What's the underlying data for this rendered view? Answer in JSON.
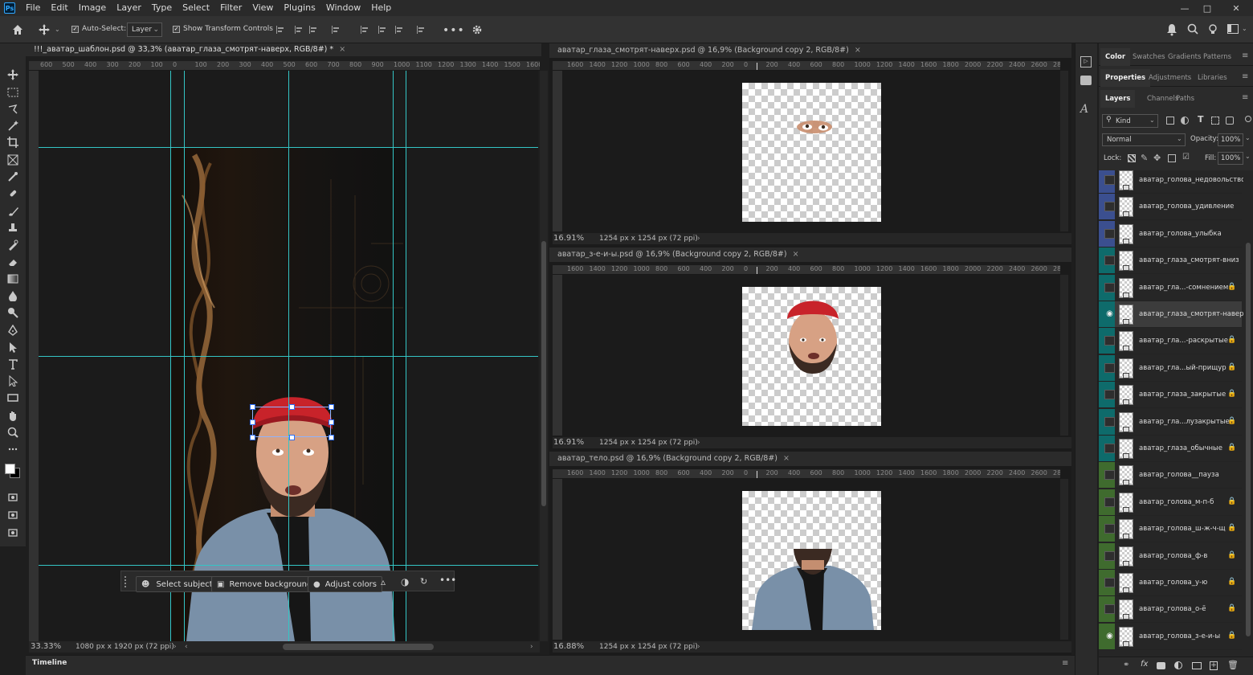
{
  "app": {
    "logo": "Ps"
  },
  "menu": [
    "File",
    "Edit",
    "Image",
    "Layer",
    "Type",
    "Select",
    "Filter",
    "View",
    "Plugins",
    "Window",
    "Help"
  ],
  "options_bar": {
    "auto_select_label": "Auto-Select:",
    "layer_dropdown": "Layer",
    "show_transform_label": "Show Transform Controls"
  },
  "documents": {
    "main": {
      "tab": "!!!_аватар_шаблон.psd @ 33,3% (аватар_глаза_смотрят-наверх, RGB/8#) *",
      "ruler_labels": [
        "600",
        "500",
        "400",
        "300",
        "200",
        "100",
        "0",
        "100",
        "200",
        "300",
        "400",
        "500",
        "600",
        "700",
        "800",
        "900",
        "1000",
        "1100",
        "1200",
        "1300",
        "1400",
        "1500",
        "1600"
      ],
      "zoom": "33.33%",
      "info": "1080 px x 1920 px (72 ppi)"
    },
    "doc2": {
      "tab": "аватар_глаза_смотрят-наверх.psd @ 16,9% (Background copy 2, RGB/8#)",
      "zoom": "16.91%",
      "info": "1254 px x 1254 px (72 ppi)"
    },
    "doc3": {
      "tab": "аватар_з-е-и-ы.psd @ 16,9% (Background copy 2, RGB/8#)",
      "zoom": "16.91%",
      "info": "1254 px x 1254 px (72 ppi)"
    },
    "doc4": {
      "tab": "аватар_тело.psd @ 16,9% (Background copy 2, RGB/8#)",
      "zoom": "16.88%",
      "info": "1254 px x 1254 px (72 ppi)"
    },
    "small_ruler_labels": [
      "1600",
      "1400",
      "1200",
      "1000",
      "800",
      "600",
      "400",
      "200",
      "0",
      "200",
      "400",
      "600",
      "800",
      "1000",
      "1200",
      "1400",
      "1600",
      "1800",
      "2000",
      "2200",
      "2400",
      "2600",
      "2800"
    ]
  },
  "contextual_bar": {
    "select_subject": "Select subject",
    "remove_background": "Remove background",
    "adjust_colors": "Adjust colors"
  },
  "timeline": {
    "label": "Timeline"
  },
  "panels": {
    "top_tabs": [
      "Color",
      "Swatches",
      "Gradients",
      "Patterns"
    ],
    "mid_tabs": [
      "Properties",
      "Adjustments",
      "Libraries"
    ],
    "layer_tabs": [
      "Layers",
      "Channels",
      "Paths"
    ],
    "kind_label": "Kind",
    "blend_mode": "Normal",
    "opacity_label": "Opacity:",
    "opacity_value": "100%",
    "lock_label": "Lock:",
    "fill_label": "Fill:",
    "fill_value": "100%"
  },
  "layers": [
    {
      "name": "аватар_голова_недовольство",
      "color": "#3b4f8f",
      "visible": false,
      "locked": false
    },
    {
      "name": "аватар_голова_удивление",
      "color": "#3b4f8f",
      "visible": false,
      "locked": false
    },
    {
      "name": "аватар_голова_улыбка",
      "color": "#3b4f8f",
      "visible": false,
      "locked": false
    },
    {
      "name": "аватар_глаза_смотрят-вниз",
      "color": "#0e6b6b",
      "visible": false,
      "locked": false
    },
    {
      "name": "аватар_гла...-сомнением",
      "color": "#0e6b6b",
      "visible": false,
      "locked": true
    },
    {
      "name": "аватар_глаза_смотрят-наверх",
      "color": "#0e6b6b",
      "visible": true,
      "locked": false,
      "selected": true
    },
    {
      "name": "аватар_гла...-раскрытые",
      "color": "#0e6b6b",
      "visible": false,
      "locked": true
    },
    {
      "name": "аватар_гла...ый-прищур",
      "color": "#0e6b6b",
      "visible": false,
      "locked": true
    },
    {
      "name": "аватар_глаза_закрытые",
      "color": "#0e6b6b",
      "visible": false,
      "locked": true
    },
    {
      "name": "аватар_гла...лузакрытые",
      "color": "#0e6b6b",
      "visible": false,
      "locked": true
    },
    {
      "name": "аватар_глаза_обычные",
      "color": "#0e6b6b",
      "visible": false,
      "locked": true
    },
    {
      "name": "аватар_голова__пауза",
      "color": "#3f6b2e",
      "visible": false,
      "locked": false
    },
    {
      "name": "аватар_голова_м-п-б",
      "color": "#3f6b2e",
      "visible": false,
      "locked": true
    },
    {
      "name": "аватар_голова_ш-ж-ч-щ",
      "color": "#3f6b2e",
      "visible": false,
      "locked": true
    },
    {
      "name": "аватар_голова_ф-в",
      "color": "#3f6b2e",
      "visible": false,
      "locked": true
    },
    {
      "name": "аватар_голова_у-ю",
      "color": "#3f6b2e",
      "visible": false,
      "locked": true
    },
    {
      "name": "аватар_голова_о-ё",
      "color": "#3f6b2e",
      "visible": false,
      "locked": true
    },
    {
      "name": "аватар_голова_з-е-и-ы",
      "color": "#3f6b2e",
      "visible": true,
      "locked": true
    }
  ],
  "colors": {
    "guide": "#34c5c5",
    "accent": "#31a8ff"
  }
}
